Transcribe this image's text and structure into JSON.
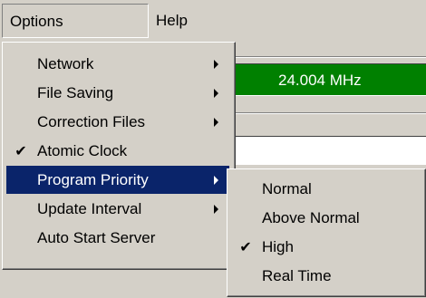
{
  "menubar": {
    "options_label": "Options",
    "help_label": "Help"
  },
  "background": {
    "frequency_value": "24.004 MHz"
  },
  "options_menu": {
    "items": [
      {
        "label": "Network",
        "has_submenu": true,
        "checked": false
      },
      {
        "label": "File Saving",
        "has_submenu": true,
        "checked": false
      },
      {
        "label": "Correction Files",
        "has_submenu": true,
        "checked": false
      },
      {
        "label": "Atomic Clock",
        "has_submenu": false,
        "checked": true
      },
      {
        "label": "Program Priority",
        "has_submenu": true,
        "checked": false,
        "selected": true
      },
      {
        "label": "Update Interval",
        "has_submenu": true,
        "checked": false
      },
      {
        "label": "Auto Start Server",
        "has_submenu": false,
        "checked": false
      }
    ]
  },
  "priority_submenu": {
    "items": [
      {
        "label": "Normal",
        "checked": false
      },
      {
        "label": "Above Normal",
        "checked": false
      },
      {
        "label": "High",
        "checked": true
      },
      {
        "label": "Real Time",
        "checked": false
      }
    ]
  },
  "colors": {
    "menu_background": "#d4d0c8",
    "selection_highlight": "#0a246a",
    "frequency_display": "#008000"
  },
  "icons": {
    "check": "check-mark-icon",
    "submenu": "submenu-arrow-icon"
  }
}
